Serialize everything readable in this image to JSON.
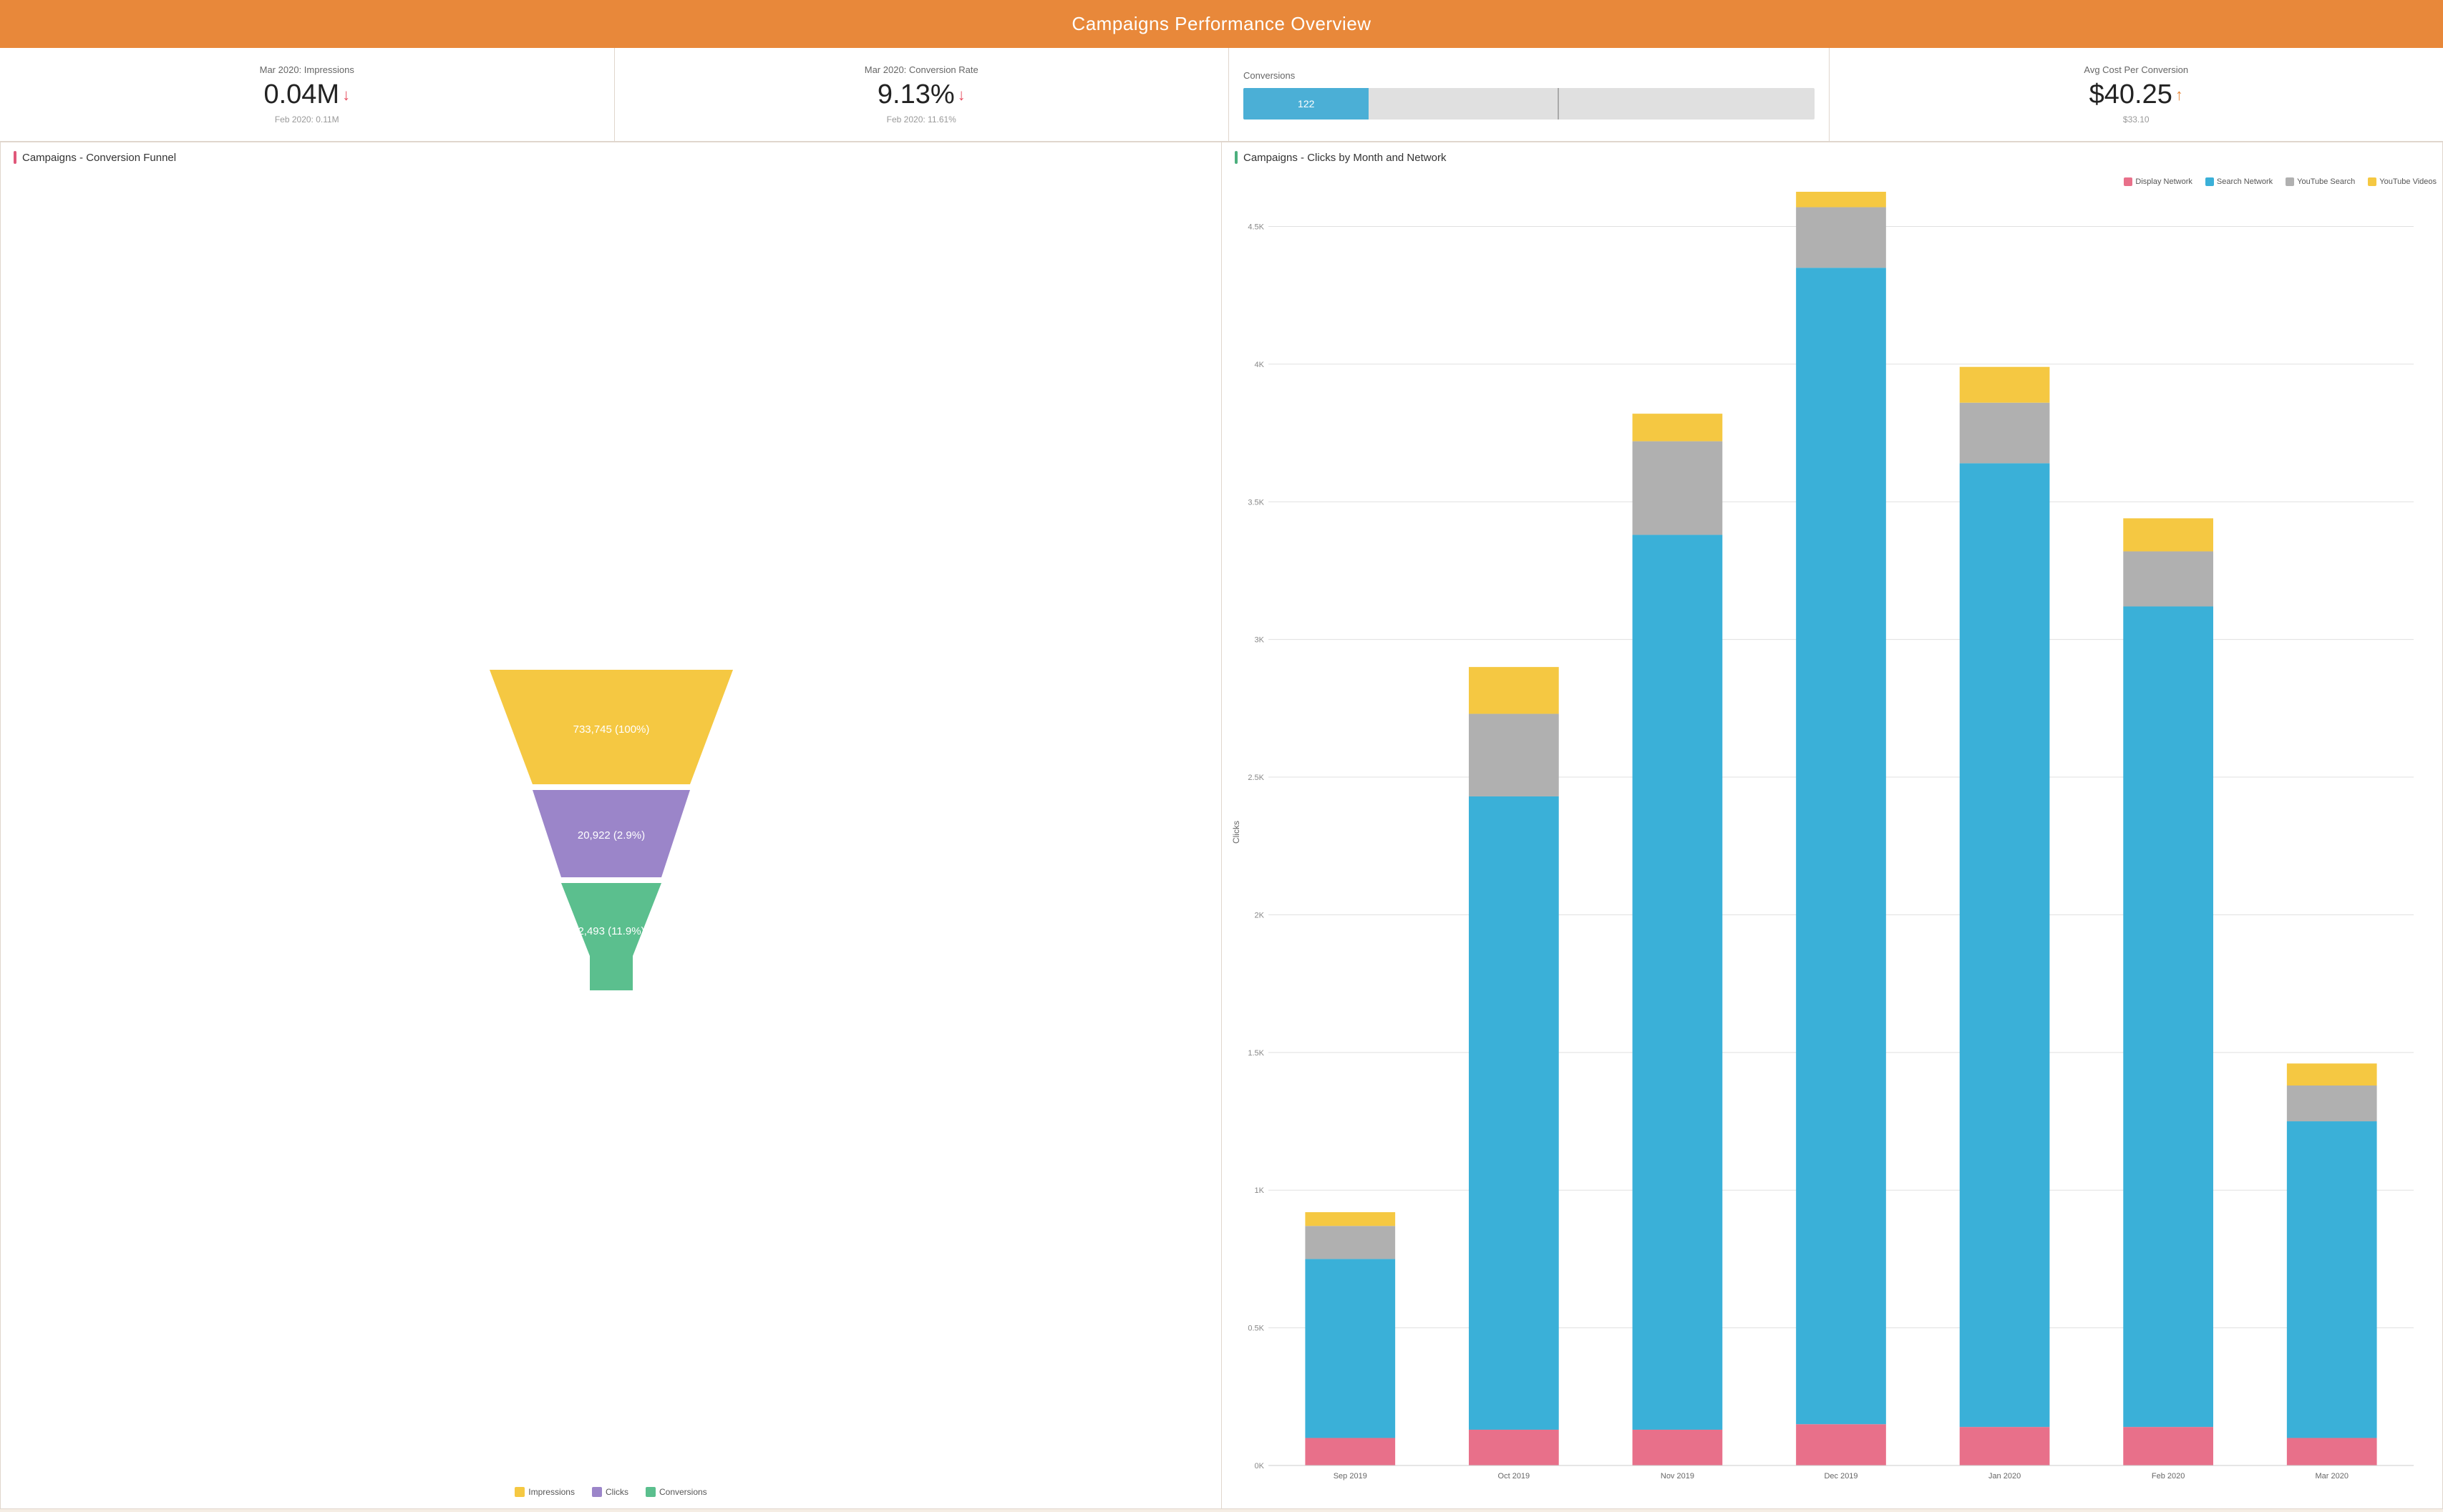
{
  "header": {
    "title": "Campaigns Performance Overview"
  },
  "kpis": {
    "impressions": {
      "label": "Mar 2020: Impressions",
      "value": "0.04M",
      "trend": "down",
      "sub": "Feb 2020: 0.11M"
    },
    "conversion_rate": {
      "label": "Mar 2020: Conversion Rate",
      "value": "9.13%",
      "trend": "down",
      "sub": "Feb 2020: 11.61%"
    },
    "conversions": {
      "label": "Conversions",
      "value": 122,
      "bar_fill_pct": 22
    },
    "avg_cost": {
      "label": "Avg Cost Per Conversion",
      "value": "$40.25",
      "trend": "up",
      "sub": "$33.10"
    }
  },
  "funnel": {
    "title": "Campaigns - Conversion Funnel",
    "levels": [
      {
        "label": "733,745 (100%)",
        "color": "#f5c842",
        "name": "Impressions"
      },
      {
        "label": "20,922 (2.9%)",
        "color": "#9b85c9",
        "name": "Clicks"
      },
      {
        "label": "2,493 (11.9%)",
        "color": "#5bbf8e",
        "name": "Conversions"
      }
    ],
    "legend": [
      {
        "name": "Impressions",
        "color": "#f5c842"
      },
      {
        "name": "Clicks",
        "color": "#9b85c9"
      },
      {
        "name": "Conversions",
        "color": "#5bbf8e"
      }
    ]
  },
  "bar_chart": {
    "title": "Campaigns - Clicks by Month and Network",
    "y_axis_label": "Clicks",
    "y_ticks": [
      "0K",
      "0.5K",
      "1K",
      "1.5K",
      "2K",
      "2.5K",
      "3K",
      "3.5K",
      "4K",
      "4.5K"
    ],
    "legend": [
      {
        "name": "Display Network",
        "color": "#e8708a"
      },
      {
        "name": "Search Network",
        "color": "#3ab0d8"
      },
      {
        "name": "YouTube Search",
        "color": "#b0b0b0"
      },
      {
        "name": "YouTube Videos",
        "color": "#f5c842"
      }
    ],
    "months": [
      "Sep 2019",
      "Oct 2019",
      "Nov 2019",
      "Dec 2019",
      "Jan 2020",
      "Feb 2020",
      "Mar 2020"
    ],
    "data": [
      {
        "month": "Sep 2019",
        "display": 100,
        "search": 650,
        "yt_search": 120,
        "yt_video": 50
      },
      {
        "month": "Oct 2019",
        "display": 130,
        "search": 2300,
        "yt_search": 300,
        "yt_video": 170
      },
      {
        "month": "Nov 2019",
        "display": 130,
        "search": 3250,
        "yt_search": 340,
        "yt_video": 100
      },
      {
        "month": "Dec 2019",
        "display": 150,
        "search": 4200,
        "yt_search": 220,
        "yt_video": 130
      },
      {
        "month": "Jan 2020",
        "display": 140,
        "search": 3500,
        "yt_search": 220,
        "yt_video": 130
      },
      {
        "month": "Feb 2020",
        "display": 140,
        "search": 2980,
        "yt_search": 200,
        "yt_video": 120
      },
      {
        "month": "Mar 2020",
        "display": 100,
        "search": 1150,
        "yt_search": 130,
        "yt_video": 80
      }
    ],
    "max_val": 4600
  }
}
